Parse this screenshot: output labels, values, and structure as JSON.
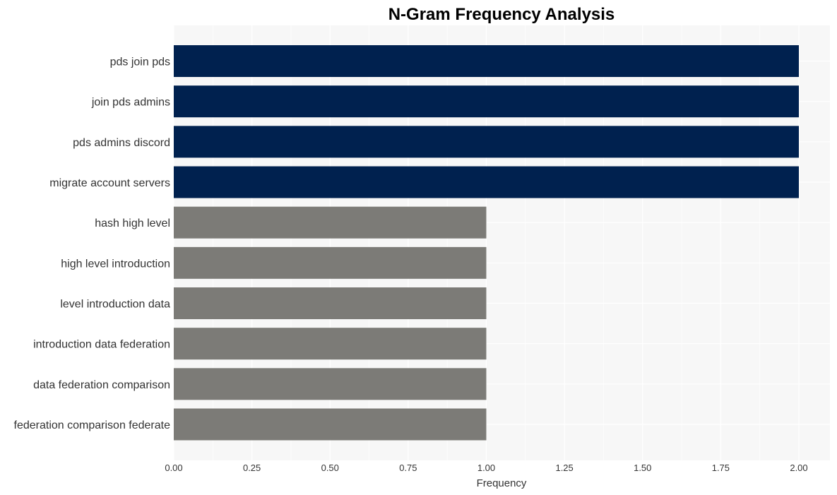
{
  "chart_data": {
    "type": "bar",
    "orientation": "horizontal",
    "title": "N-Gram Frequency Analysis",
    "xlabel": "Frequency",
    "ylabel": "",
    "categories": [
      "pds join pds",
      "join pds admins",
      "pds admins discord",
      "migrate account servers",
      "hash high level",
      "high level introduction",
      "level introduction data",
      "introduction data federation",
      "data federation comparison",
      "federation comparison federate"
    ],
    "values": [
      2,
      2,
      2,
      2,
      1,
      1,
      1,
      1,
      1,
      1
    ],
    "xlim": [
      0,
      2.1
    ],
    "xticks": [
      0,
      0.25,
      0.5,
      0.75,
      1.0,
      1.25,
      1.5,
      1.75,
      2.0
    ],
    "xtick_labels": [
      "0.00",
      "0.25",
      "0.50",
      "0.75",
      "1.00",
      "1.25",
      "1.50",
      "1.75",
      "2.00"
    ],
    "grid": true,
    "legend": "none",
    "colors": {
      "highlight": "#00214f",
      "normal": "#7c7b77",
      "panel_background": "#f7f7f7",
      "gridline": "#ffffff"
    },
    "highlight_rule": "value equals max"
  }
}
